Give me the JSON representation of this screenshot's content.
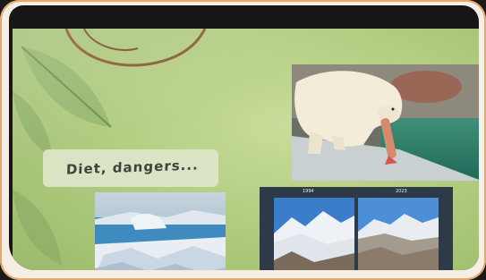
{
  "slide": {
    "heading": "Diet, dangers...",
    "comparison": {
      "left_label": "1994",
      "right_label": "2023"
    }
  },
  "colors": {
    "frame": "#f6eee4",
    "frame_edge": "#e8a86a",
    "screen_green": "#b3cd82",
    "title_box": "#dde6c8",
    "comparison_panel": "#2f3a48"
  },
  "icons": [
    "leaf-icon",
    "vine-icon"
  ]
}
